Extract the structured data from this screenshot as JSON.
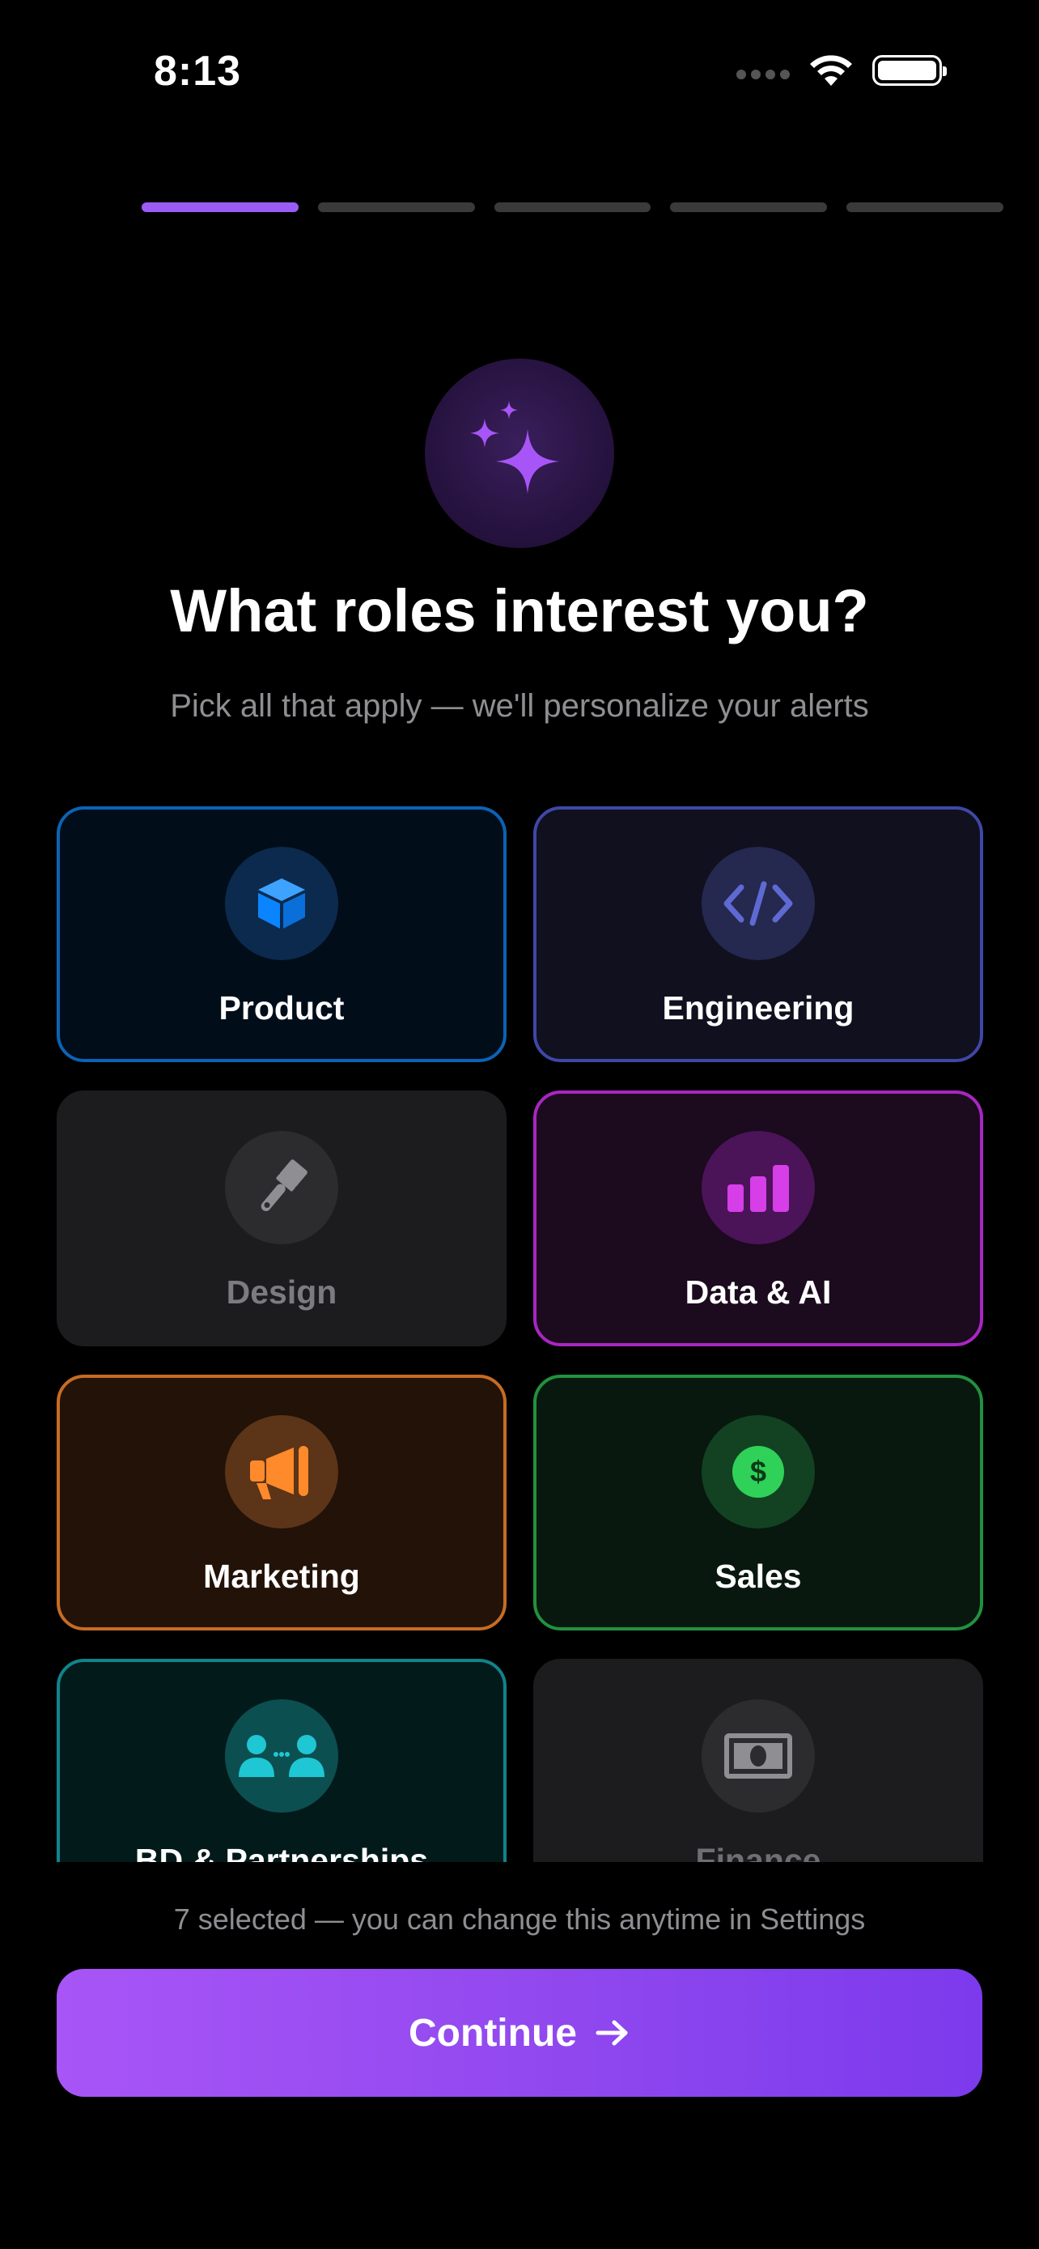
{
  "status_bar": {
    "time": "8:13"
  },
  "progress": {
    "total_steps": 5,
    "current_step": 1
  },
  "header": {
    "title": "What roles interest you?",
    "subtitle": "Pick all that apply — we'll personalize your alerts"
  },
  "roles": [
    {
      "label": "Product",
      "icon": "cube-icon",
      "selected": true,
      "color": "#0a84ff"
    },
    {
      "label": "Engineering",
      "icon": "code-icon",
      "selected": true,
      "color": "#5e6ad2"
    },
    {
      "label": "Design",
      "icon": "paintbrush-icon",
      "selected": false,
      "color": "#8e8e93"
    },
    {
      "label": "Data & AI",
      "icon": "bar-chart-icon",
      "selected": true,
      "color": "#d63ee8"
    },
    {
      "label": "Marketing",
      "icon": "megaphone-icon",
      "selected": true,
      "color": "#ff8a2b"
    },
    {
      "label": "Sales",
      "icon": "dollar-icon",
      "selected": true,
      "color": "#30d158"
    },
    {
      "label": "BD & Partnerships",
      "icon": "people-icon",
      "selected": true,
      "color": "#1fc7d4"
    },
    {
      "label": "Finance",
      "icon": "banknote-icon",
      "selected": false,
      "color": "#8e8e93"
    }
  ],
  "footer": {
    "selection_note": "7 selected — you can change this anytime in Settings",
    "continue_label": "Continue"
  },
  "colors": {
    "accent": "#9b5cf6",
    "background": "#000000"
  }
}
